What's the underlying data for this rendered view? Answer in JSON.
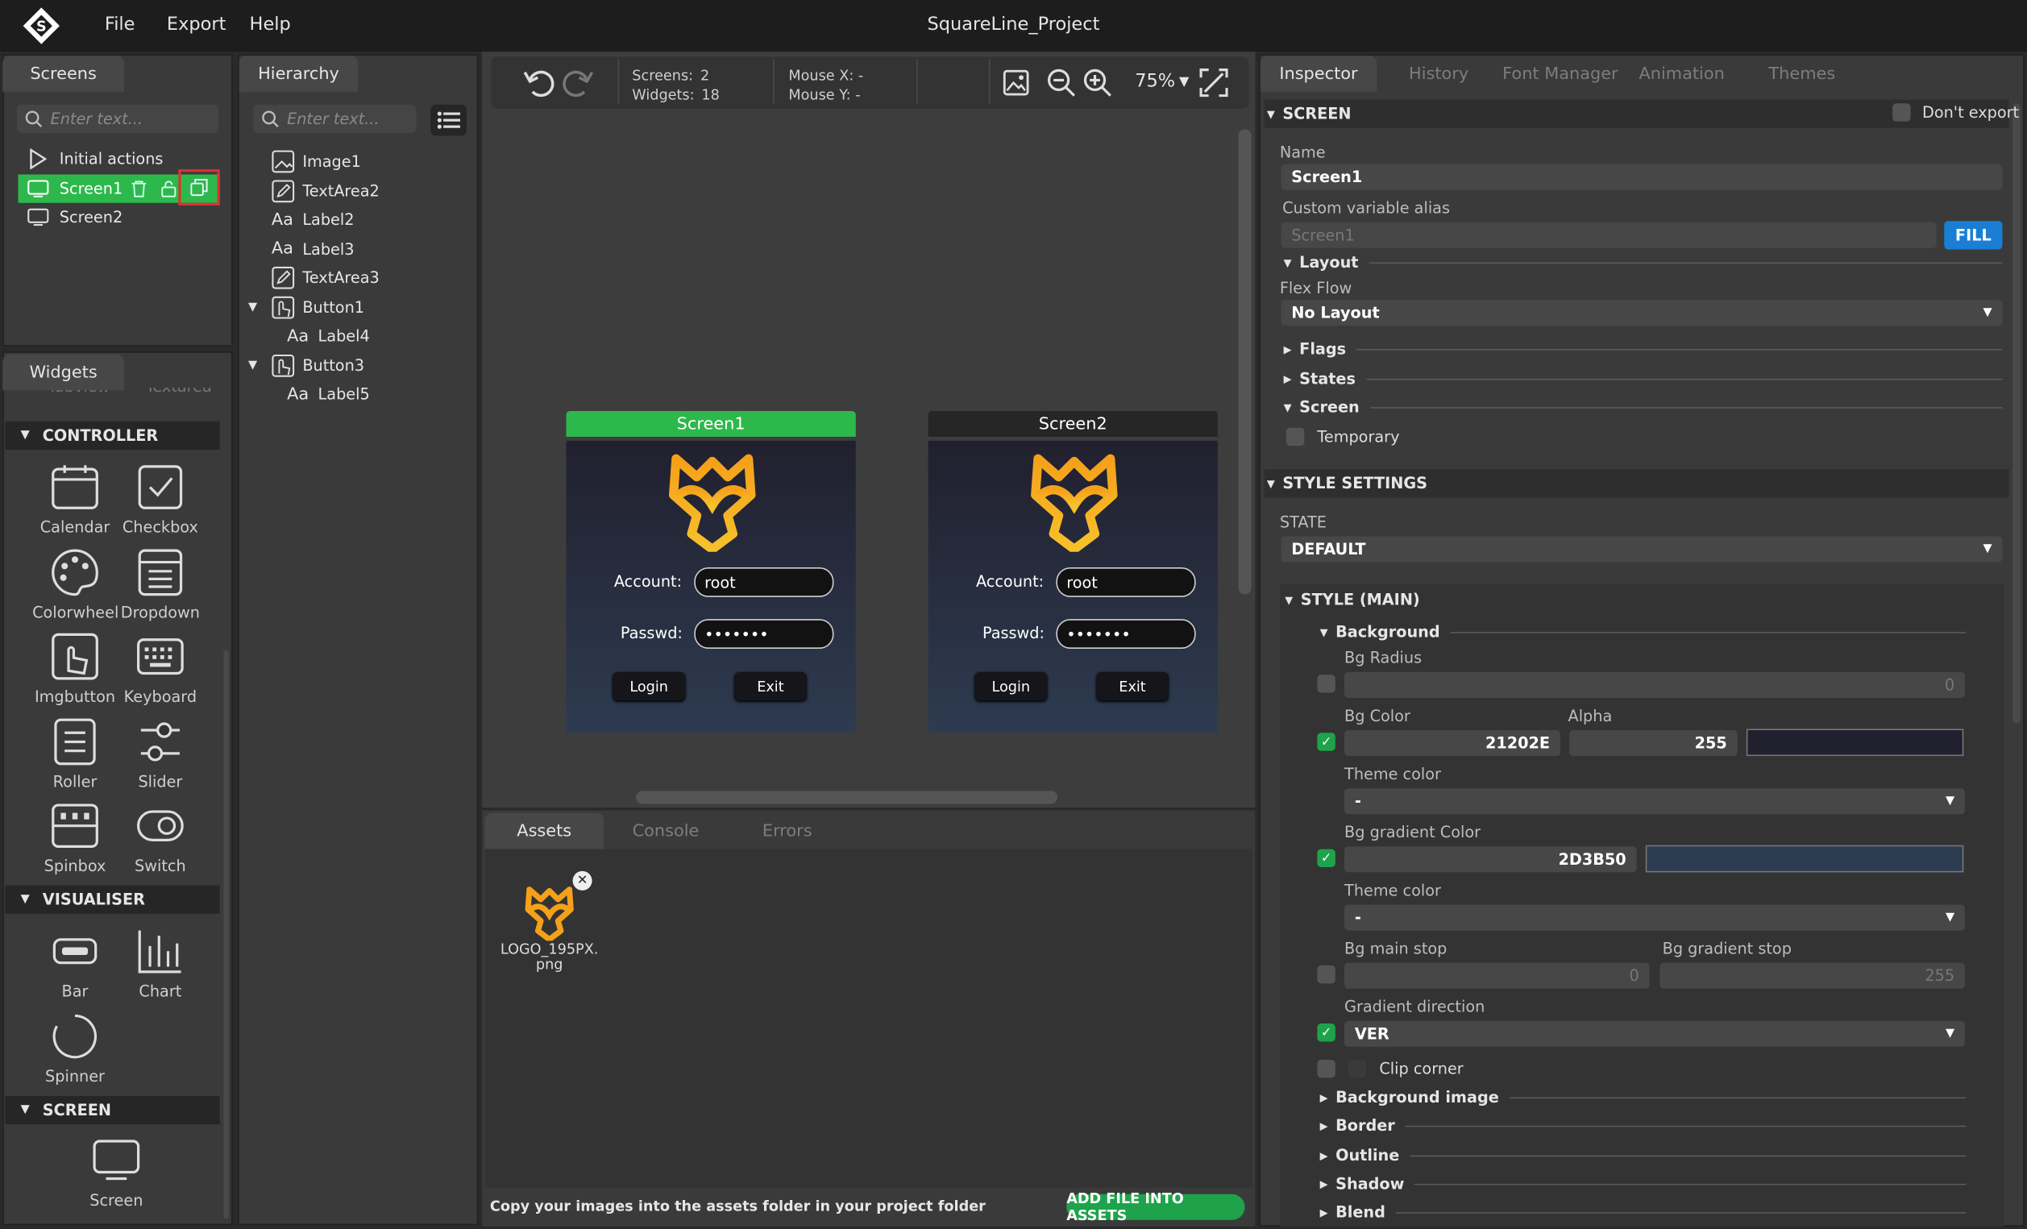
{
  "app": {
    "title": "SquareLine_Project",
    "menu": [
      "File",
      "Export",
      "Help"
    ]
  },
  "colors": {
    "accent_green": "#2db84b",
    "accent_blue": "#1a7fd4",
    "highlight_red": "#e03030",
    "bg_color": "#21202E",
    "bg_gradient_color": "#2D3B50",
    "logo_orange": "#f59e0b"
  },
  "screens_panel": {
    "tab": "Screens",
    "search_placeholder": "Enter text...",
    "items": [
      {
        "label": "Initial actions",
        "icon": "play-icon"
      },
      {
        "label": "Screen1",
        "icon": "monitor-icon",
        "selected": true
      },
      {
        "label": "Screen2",
        "icon": "monitor-icon"
      }
    ]
  },
  "hierarchy": {
    "tab": "Hierarchy",
    "search_placeholder": "Enter text...",
    "items": [
      {
        "label": "Image1",
        "icon": "image-icon"
      },
      {
        "label": "TextArea2",
        "icon": "edit-icon"
      },
      {
        "label": "Label2",
        "icon": "text-icon"
      },
      {
        "label": "Label3",
        "icon": "text-icon"
      },
      {
        "label": "TextArea3",
        "icon": "edit-icon"
      },
      {
        "label": "Button1",
        "icon": "button-icon",
        "expanded": true
      },
      {
        "label": "Label4",
        "icon": "text-icon",
        "child": true
      },
      {
        "label": "Button3",
        "icon": "button-icon",
        "expanded": true
      },
      {
        "label": "Label5",
        "icon": "text-icon",
        "child": true
      }
    ],
    "text_icon_glyph": "Aa"
  },
  "widgets": {
    "tab": "Widgets",
    "partial_labels": [
      "Tabview",
      "Textarea"
    ],
    "controller": {
      "title": "CONTROLLER",
      "items": [
        {
          "label": "Calendar",
          "icon": "calendar-icon"
        },
        {
          "label": "Checkbox",
          "icon": "checkbox-icon"
        },
        {
          "label": "Colorwheel",
          "icon": "palette-icon"
        },
        {
          "label": "Dropdown",
          "icon": "dropdown-icon"
        },
        {
          "label": "Imgbutton",
          "icon": "imgbutton-icon"
        },
        {
          "label": "Keyboard",
          "icon": "keyboard-icon"
        },
        {
          "label": "Roller",
          "icon": "roller-icon"
        },
        {
          "label": "Slider",
          "icon": "slider-icon"
        },
        {
          "label": "Spinbox",
          "icon": "spinbox-icon"
        },
        {
          "label": "Switch",
          "icon": "switch-icon"
        }
      ]
    },
    "visualiser": {
      "title": "VISUALISER",
      "items": [
        {
          "label": "Bar",
          "icon": "bar-icon"
        },
        {
          "label": "Chart",
          "icon": "chart-icon"
        },
        {
          "label": "Spinner",
          "icon": "spinner-icon"
        }
      ]
    },
    "screen": {
      "title": "SCREEN",
      "items": [
        {
          "label": "Screen",
          "icon": "monitor-icon"
        }
      ]
    }
  },
  "toolbar": {
    "screens_label": "Screens:",
    "screens_value": "2",
    "widgets_label": "Widgets:",
    "widgets_value": "18",
    "mouse_x": "Mouse X: -",
    "mouse_y": "Mouse Y: -",
    "zoom": "75%"
  },
  "canvas": {
    "screens": [
      {
        "name": "Screen1",
        "selected": true,
        "account_label": "Account:",
        "account_value": "root",
        "passwd_label": "Passwd:",
        "passwd_value": "•••••••",
        "login": "Login",
        "exit": "Exit"
      },
      {
        "name": "Screen2",
        "selected": false,
        "account_label": "Account:",
        "account_value": "root",
        "passwd_label": "Passwd:",
        "passwd_value": "•••••••",
        "login": "Login",
        "exit": "Exit"
      }
    ]
  },
  "bottom": {
    "tabs": [
      "Assets",
      "Console",
      "Errors"
    ],
    "asset_name": "LOGO_195PX.\npng",
    "hint": "Copy your images into the assets folder in your project folder",
    "add_button": "ADD FILE INTO ASSETS"
  },
  "inspector": {
    "tabs": [
      "Inspector",
      "History",
      "Font Manager",
      "Animation",
      "Themes"
    ],
    "screen_section": "SCREEN",
    "dont_export": "Don't export",
    "name_label": "Name",
    "name_value": "Screen1",
    "alias_label": "Custom variable alias",
    "alias_placeholder": "Screen1",
    "fill_button": "FILL",
    "layout": "Layout",
    "flex_flow_label": "Flex Flow",
    "flex_flow_value": "No Layout",
    "flags": "Flags",
    "states": "States",
    "screen_sub": "Screen",
    "temporary": "Temporary",
    "style_settings": "STYLE SETTINGS",
    "state_label": "STATE",
    "state_value": "DEFAULT",
    "style_main": "STYLE (MAIN)",
    "background": "Background",
    "bg_radius_label": "Bg Radius",
    "bg_radius_value": "0",
    "bg_color_label": "Bg Color",
    "bg_color_value": "21202E",
    "alpha_label": "Alpha",
    "alpha_value": "255",
    "theme_color_label": "Theme color",
    "theme_color_value": "-",
    "bg_gradient_label": "Bg gradient Color",
    "bg_gradient_value": "2D3B50",
    "theme_color2_value": "-",
    "bg_main_stop_label": "Bg main stop",
    "bg_main_stop_value": "0",
    "bg_gradient_stop_label": "Bg gradient stop",
    "bg_gradient_stop_value": "255",
    "gradient_direction_label": "Gradient direction",
    "gradient_direction_value": "VER",
    "clip_corner": "Clip corner",
    "collapsed_sections": [
      "Background image",
      "Border",
      "Outline",
      "Shadow",
      "Blend"
    ]
  }
}
